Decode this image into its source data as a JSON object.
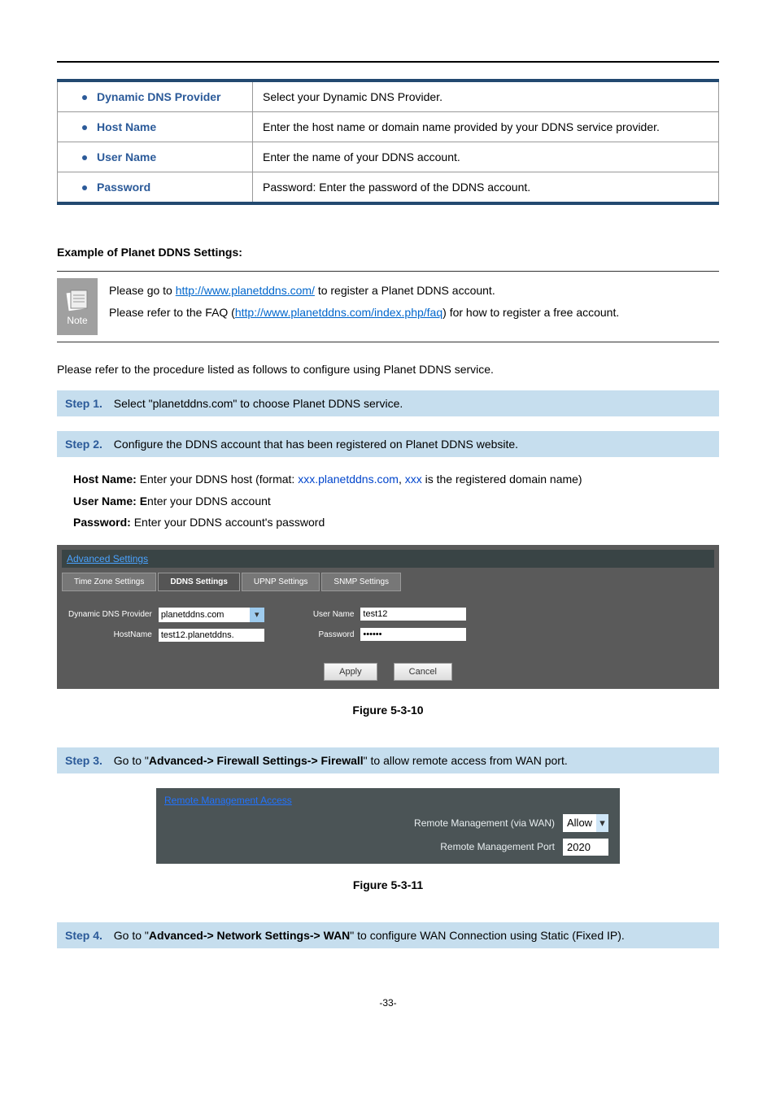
{
  "params_table": [
    {
      "label": "Dynamic DNS Provider",
      "desc": "Select your Dynamic DNS Provider."
    },
    {
      "label": "Host Name",
      "desc": "Enter the host name or domain name provided by your DDNS service provider."
    },
    {
      "label": "User Name",
      "desc": "Enter the name of your DDNS account."
    },
    {
      "label": "Password",
      "desc": "Password: Enter the password of the DDNS account."
    }
  ],
  "example_heading": "Example of Planet DDNS Settings:",
  "note": {
    "label": "Note",
    "line1_prefix": "Please go to ",
    "line1_link": "http://www.planetddns.com/",
    "line1_suffix": " to register a Planet DDNS account.",
    "line2_prefix": "Please refer to the FAQ (",
    "line2_link": "http://www.planetddns.com/index.php/faq",
    "line2_suffix": ") for how to register a free account."
  },
  "intro": "Please refer to the procedure listed as follows to configure using Planet DDNS service.",
  "steps": {
    "s1": {
      "label": "Step 1.",
      "text": "Select \"planetddns.com\" to choose Planet DDNS service."
    },
    "s2": {
      "label": "Step 2.",
      "text": "Configure the DDNS account that has been registered on Planet DDNS website.",
      "host_label": "Host Name: ",
      "host_text_a": "Enter your DDNS host (format: ",
      "host_text_b": "xxx.planetddns.com",
      "host_text_c": ", ",
      "host_text_d": "xxx",
      "host_text_e": " is the registered domain name)",
      "user_label": "User Name: E",
      "user_text": "nter your DDNS account",
      "pw_label": "Password: ",
      "pw_text": "Enter your DDNS account's password"
    },
    "s3": {
      "label": "Step 3.",
      "pre": "Go to \"",
      "bold": "Advanced-> Firewall Settings-> Firewall",
      "post": "\" to allow remote access from WAN port."
    },
    "s4": {
      "label": "Step 4.",
      "pre": "Go to \"",
      "bold": "Advanced-> Network Settings-> WAN",
      "post": "\" to configure WAN Connection using Static (Fixed IP)."
    }
  },
  "fig1": {
    "adv_header": "Advanced Settings",
    "tabs": [
      "Time Zone Settings",
      "DDNS Settings",
      "UPNP Settings",
      "SNMP Settings"
    ],
    "active_tab": 1,
    "provider_label": "Dynamic DNS Provider",
    "provider_value": "planetddns.com",
    "hostname_label": "HostName",
    "hostname_value": "test12.planetddns.",
    "username_label": "User Name",
    "username_value": "test12",
    "password_label": "Password",
    "password_value": "••••••",
    "apply": "Apply",
    "cancel": "Cancel",
    "caption": "Figure 5-3-10"
  },
  "fig2": {
    "header": "Remote Management Access",
    "rm_via_wan_label": "Remote Management (via WAN)",
    "rm_via_wan_value": "Allow",
    "rm_port_label": "Remote Management Port",
    "rm_port_value": "2020",
    "caption": "Figure 5-3-11"
  },
  "page_number": "-33-"
}
